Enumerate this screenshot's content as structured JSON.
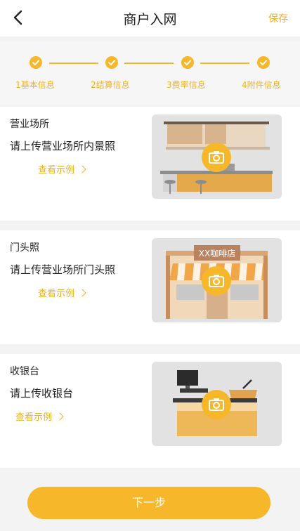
{
  "header": {
    "title": "商户入网",
    "save_label": "保存"
  },
  "steps": [
    {
      "label": "1基本信息",
      "done": true
    },
    {
      "label": "2结算信息",
      "done": true
    },
    {
      "label": "3费率信息",
      "done": true
    },
    {
      "label": "4附件信息",
      "done": true
    }
  ],
  "cards": [
    {
      "title": "营业场所",
      "desc": "请上传营业场所内景照",
      "link": "查看示例"
    },
    {
      "title": "门头照",
      "desc": "请上传营业场所门头照",
      "link": "查看示例"
    },
    {
      "title": "收银台",
      "desc": "请上传收银台",
      "link": "查看示例"
    }
  ],
  "illustrations": {
    "shop_sign": "XX咖啡店"
  },
  "footer": {
    "next_label": "下一步"
  },
  "colors": {
    "accent": "#f7b72b",
    "accent_text": "#f2b11c",
    "background": "#f3f3f3"
  }
}
